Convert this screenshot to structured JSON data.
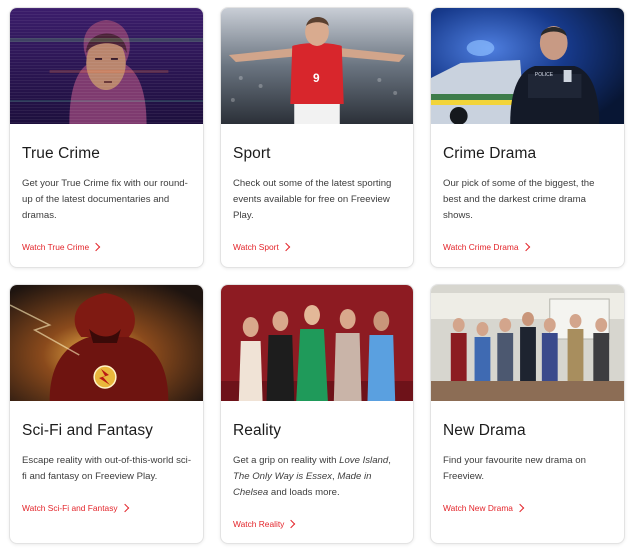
{
  "cards": [
    {
      "title": "True Crime",
      "description": "Get your True Crime fix with our round-up of the latest documentaries and dramas.",
      "link": "Watch True Crime",
      "image": "woman-portrait-glitch-image"
    },
    {
      "title": "Sport",
      "description": "Check out some of the latest sporting events available for free on Freeview Play.",
      "link": "Watch Sport",
      "image": "footballer-celebrating-image"
    },
    {
      "title": "Crime Drama",
      "description": "Our pick of some of the biggest, the best and the darkest crime drama shows.",
      "link": "Watch Crime Drama",
      "image": "police-officer-car-image"
    },
    {
      "title": "Sci-Fi and Fantasy",
      "description": "Escape reality with out-of-this-world sci-fi and fantasy on Freeview Play.",
      "link": "Watch Sci-Fi and Fantasy",
      "image": "superhero-lightning-image"
    },
    {
      "title": "Reality",
      "description_parts": [
        "Get a grip on reality with ",
        "Love Island",
        ", ",
        "The Only Way is Essex",
        ", ",
        "Made in Chelsea",
        " and loads more."
      ],
      "link": "Watch Reality",
      "image": "reality-cast-group-image"
    },
    {
      "title": "New Drama",
      "description": "Find your favourite new drama on Freeview.",
      "link": "Watch New Drama",
      "image": "drama-cast-group-image"
    }
  ],
  "colors": {
    "accent": "#e3252b",
    "text": "#1c1c1c",
    "body_text": "#3d3d3d",
    "border": "#e3e3e3"
  }
}
